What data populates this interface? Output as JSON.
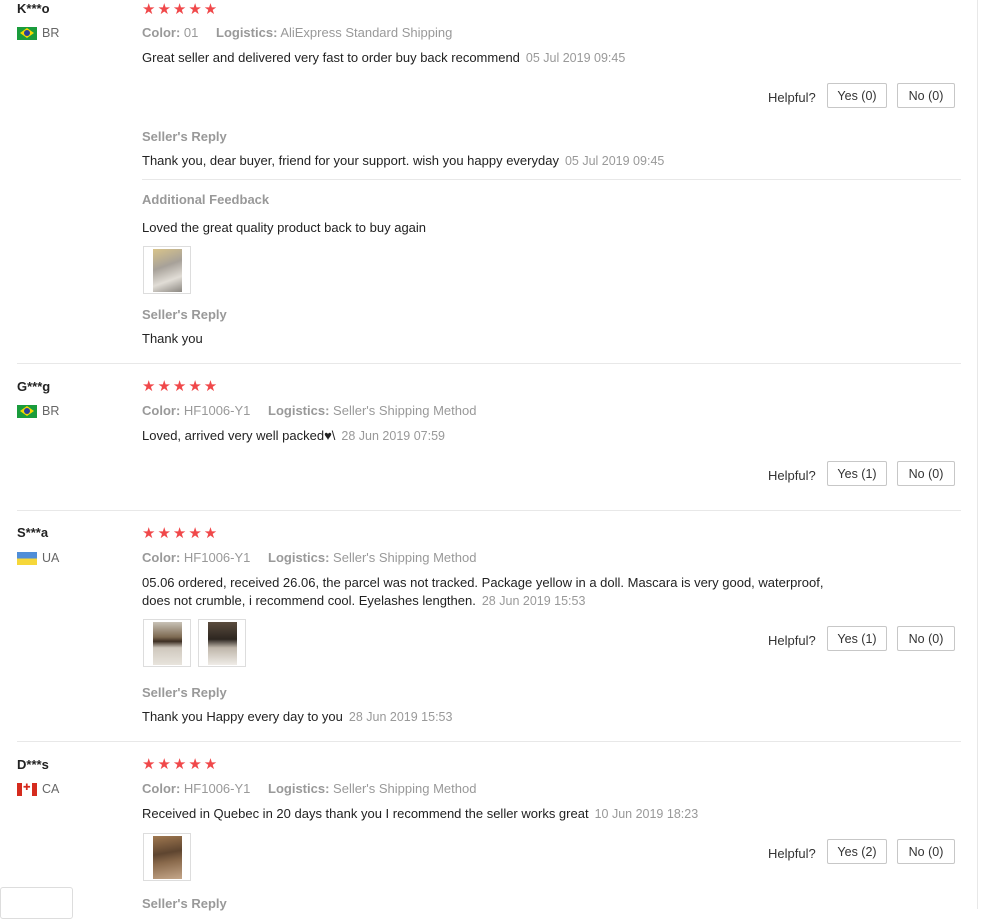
{
  "helpful_label": "Helpful?",
  "reviews": [
    {
      "user": "K***o",
      "country": "BR",
      "stars": "★★★★★",
      "color_label": "Color:",
      "color_value": "01",
      "logistics_label": "Logistics:",
      "logistics_value": "AliExpress Standard Shipping",
      "text": "Great seller and delivered very fast to order buy back recommend",
      "date": "05 Jul 2019 09:45",
      "yes": "Yes (0)",
      "no": "No (0)",
      "reply_title": "Seller's Reply",
      "reply_text": "Thank you, dear buyer, friend for your support. wish you happy everyday",
      "reply_date": "05 Jul 2019 09:45",
      "additional_title": "Additional Feedback",
      "additional_text": "Loved the great quality product back to buy again",
      "additional_reply_title": "Seller's Reply",
      "additional_reply_text": "Thank you"
    },
    {
      "user": "G***g",
      "country": "BR",
      "stars": "★★★★★",
      "color_label": "Color:",
      "color_value": "HF1006-Y1",
      "logistics_label": "Logistics:",
      "logistics_value": "Seller's Shipping Method",
      "text": "Loved, arrived very well packed♥\\",
      "date": "28 Jun 2019 07:59",
      "yes": "Yes (1)",
      "no": "No (0)"
    },
    {
      "user": "S***a",
      "country": "UA",
      "stars": "★★★★★",
      "color_label": "Color:",
      "color_value": "HF1006-Y1",
      "logistics_label": "Logistics:",
      "logistics_value": "Seller's Shipping Method",
      "text_line1": "05.06 ordered, received 26.06, the parcel was not tracked. Package yellow in a doll. Mascara is very good, waterproof,",
      "text_line2": "does not crumble, i recommend cool. Eyelashes lengthen.",
      "date": "28 Jun 2019 15:53",
      "yes": "Yes (1)",
      "no": "No (0)",
      "reply_title": "Seller's Reply",
      "reply_text": "Thank you Happy every day to you",
      "reply_date": "28 Jun 2019 15:53"
    },
    {
      "user": "D***s",
      "country": "CA",
      "stars": "★★★★★",
      "color_label": "Color:",
      "color_value": "HF1006-Y1",
      "logistics_label": "Logistics:",
      "logistics_value": "Seller's Shipping Method",
      "text": "Received in Quebec in 20 days thank you I recommend the seller works great",
      "date": "10 Jun 2019 18:23",
      "yes": "Yes (2)",
      "no": "No (0)",
      "reply_title": "Seller's Reply"
    }
  ]
}
